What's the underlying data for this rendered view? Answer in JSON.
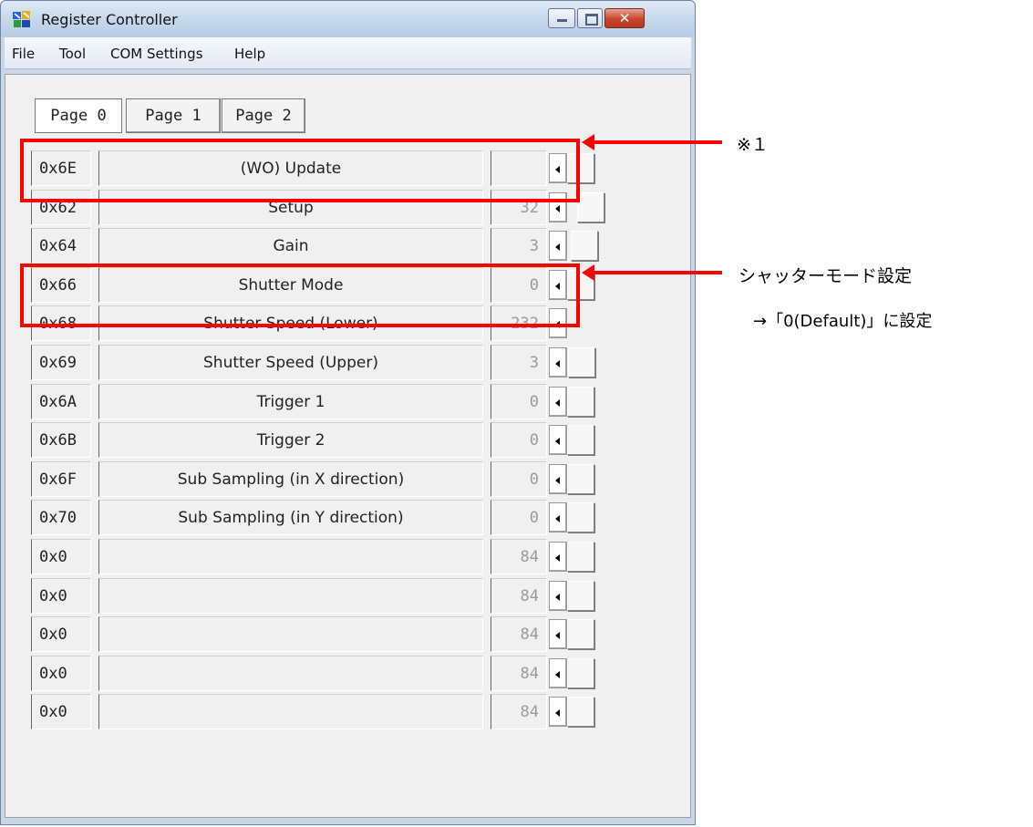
{
  "window": {
    "title": "Register Controller"
  },
  "menu": [
    "File",
    "Tool",
    "COM Settings",
    "Help"
  ],
  "tabs": [
    "Page 0",
    "Page 1",
    "Page 2"
  ],
  "registers": [
    {
      "addr": "0x6E",
      "name": "(WO) Update",
      "value": "",
      "slider_level": 0.0
    },
    {
      "addr": "0x62",
      "name": "Setup",
      "value": "32",
      "slider_level": 0.13
    },
    {
      "addr": "0x64",
      "name": "Gain",
      "value": "3",
      "slider_level": 0.05
    },
    {
      "addr": "0x66",
      "name": "Shutter Mode",
      "value": "0",
      "slider_level": 0.0
    },
    {
      "addr": "0x68",
      "name": "Shutter Speed (Lower)",
      "value": "232",
      "slider_level": 0.91
    },
    {
      "addr": "0x69",
      "name": "Shutter Speed (Upper)",
      "value": "3",
      "slider_level": 0.01
    },
    {
      "addr": "0x6A",
      "name": "Trigger 1",
      "value": "0",
      "slider_level": 0.0
    },
    {
      "addr": "0x6B",
      "name": "Trigger 2",
      "value": "0",
      "slider_level": 0.0
    },
    {
      "addr": "0x6F",
      "name": "Sub Sampling (in X direction)",
      "value": "0",
      "slider_level": 0.0
    },
    {
      "addr": "0x70",
      "name": "Sub Sampling (in Y direction)",
      "value": "0",
      "slider_level": 0.0
    },
    {
      "addr": "0x0",
      "name": "",
      "value": "84",
      "slider_level": 0.0
    },
    {
      "addr": "0x0",
      "name": "",
      "value": "84",
      "slider_level": 0.0
    },
    {
      "addr": "0x0",
      "name": "",
      "value": "84",
      "slider_level": 0.0
    },
    {
      "addr": "0x0",
      "name": "",
      "value": "84",
      "slider_level": 0.0
    },
    {
      "addr": "0x0",
      "name": "",
      "value": "84",
      "slider_level": 0.0
    }
  ],
  "annotations": {
    "note1": "※１",
    "shutter_heading": "シャッターモード設定",
    "shutter_detail": "→「0(Default)」に設定"
  },
  "colors": {
    "annotation": "#ff0000",
    "value_text": "#9a9a9a"
  }
}
